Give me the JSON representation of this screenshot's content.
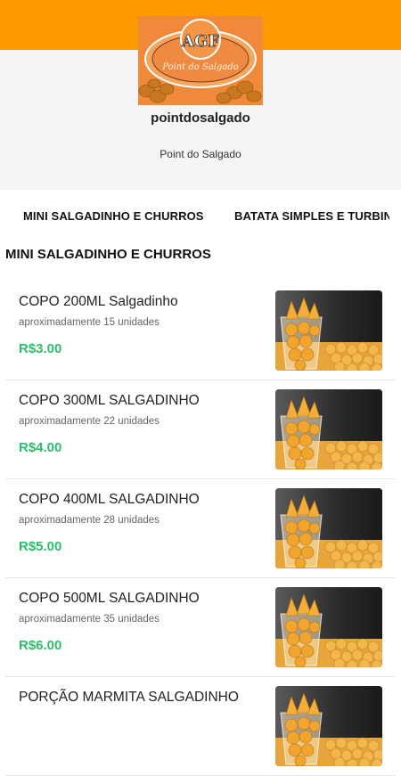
{
  "header": {
    "logo_text": "AGF",
    "logo_script": "Point do Salgado",
    "store_handle": "pointdosalgado",
    "store_name": "Point do Salgado"
  },
  "tabs": [
    {
      "label": "MINI SALGADINHO E CHURROS"
    },
    {
      "label": "BATATA SIMPLES E TURBINADA"
    }
  ],
  "section": {
    "title": "MINI SALGADINHO E CHURROS"
  },
  "products": [
    {
      "name": "COPO 200ML Salgadinho",
      "description": "aproximadamente 15 unidades",
      "price": "R$3.00"
    },
    {
      "name": "COPO 300ML SALGADINHO",
      "description": "aproximadamente 22 unidades",
      "price": "R$4.00"
    },
    {
      "name": "COPO 400ML SALGADINHO",
      "description": "aproximadamente 28 unidades",
      "price": "R$5.00"
    },
    {
      "name": "COPO 500ML SALGADINHO",
      "description": "aproximadamente 35 unidades",
      "price": "R$6.00"
    },
    {
      "name": "PORÇÃO MARMITA SALGADINHO",
      "description": "",
      "price": ""
    }
  ],
  "colors": {
    "brand": "#ff9900",
    "price": "#2dbe6c"
  }
}
